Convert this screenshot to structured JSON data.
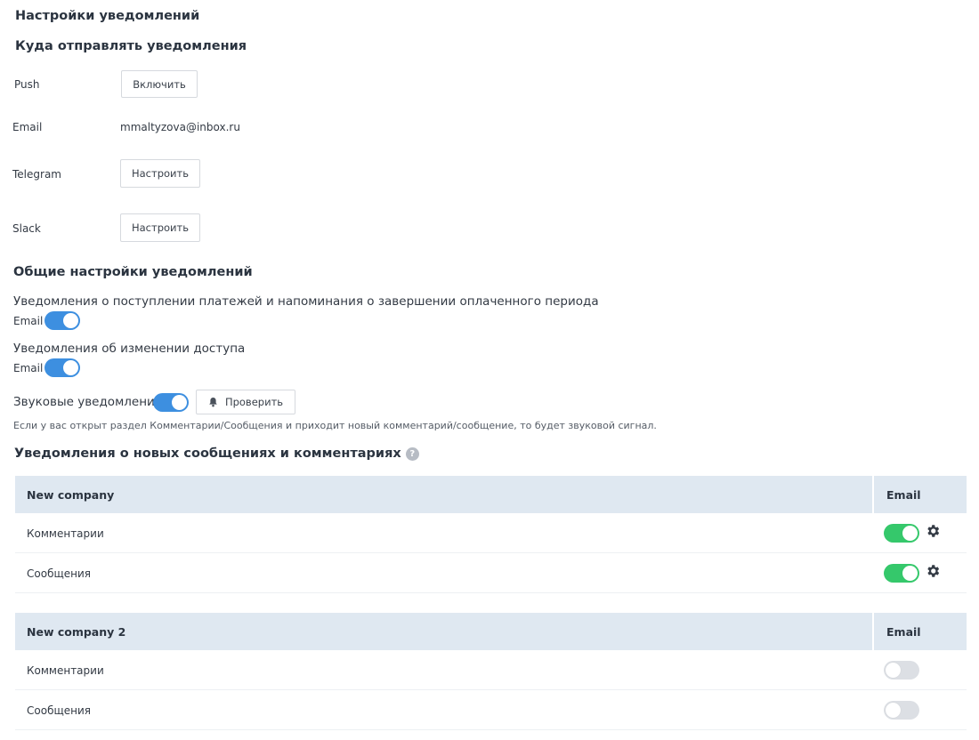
{
  "page_title": "Настройки уведомлений",
  "destinations": {
    "title": "Куда отправлять уведомления",
    "push": {
      "label": "Push",
      "button": "Включить"
    },
    "email": {
      "label": "Email",
      "value": "mmaltyzova@inbox.ru"
    },
    "telegram": {
      "label": "Telegram",
      "button": "Настроить"
    },
    "slack": {
      "label": "Slack",
      "button": "Настроить"
    }
  },
  "general": {
    "title": "Общие настройки уведомлений",
    "payments": {
      "text": "Уведомления о поступлении платежей и напоминания о завершении оплаченного периода",
      "channel": "Email",
      "enabled": true
    },
    "access": {
      "text": "Уведомления об изменении доступа",
      "channel": "Email",
      "enabled": true
    },
    "sound": {
      "label": "Звуковые уведомления",
      "enabled": true,
      "test_button": "Проверить",
      "hint": "Если у вас открыт раздел Комментарии/Сообщения и приходит новый комментарий/сообщение, то будет звуковой сигнал."
    }
  },
  "messages": {
    "title": "Уведомления о новых сообщениях и комментариях",
    "companies": [
      {
        "name": "New company",
        "column": "Email",
        "rows": [
          {
            "label": "Комментарии",
            "enabled": true
          },
          {
            "label": "Сообщения",
            "enabled": true
          }
        ]
      },
      {
        "name": "New company 2",
        "column": "Email",
        "rows": [
          {
            "label": "Комментарии",
            "enabled": false
          },
          {
            "label": "Сообщения",
            "enabled": false
          }
        ]
      }
    ]
  },
  "colors": {
    "toggle_blue": "#3d8fe0",
    "toggle_green": "#35c86b",
    "table_header": "#dfe8f1"
  },
  "icons": {
    "bell": "bell-icon",
    "gear": "gear-icon",
    "help": "help-icon"
  }
}
